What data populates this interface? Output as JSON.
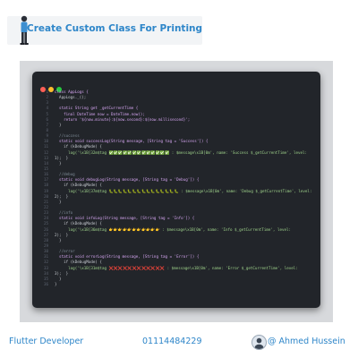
{
  "header": {
    "title": "Create Custom Class For Printing"
  },
  "editor": {
    "window_buttons": [
      "#ff5f56",
      "#ffbd2e",
      "#27c93f"
    ],
    "lines": [
      {
        "n": "1",
        "text": "class AppLogs {"
      },
      {
        "n": "2",
        "text": "  AppLogs._();"
      },
      {
        "n": "3",
        "text": ""
      },
      {
        "n": "4",
        "text": "  static String get _getCurrentTime {"
      },
      {
        "n": "5",
        "text": "    final DateTime now = DateTime.now();"
      },
      {
        "n": "6",
        "text": "    return '${now.minute}:${now.second}:${now.millisecond}';"
      },
      {
        "n": "7",
        "text": "  }"
      },
      {
        "n": "8",
        "text": ""
      },
      {
        "n": "9",
        "text": "  //success"
      },
      {
        "n": "10",
        "text": "  static void successLog(String message, [String tag = 'Success']) {"
      },
      {
        "n": "11",
        "text": "    if (kDebugMode) {"
      },
      {
        "n": "12",
        "text": "      log('\\x1B[32m$tag ✅✅✅✅✅✅✅✅✅✅✅✅✅ : $message\\x1B[0m', name: 'Success $_getCurrentTime', level:"
      },
      {
        "n": "13",
        "text": "1);  }"
      },
      {
        "n": "14",
        "text": "  }"
      },
      {
        "n": "15",
        "text": ""
      },
      {
        "n": "16",
        "text": "  //debug"
      },
      {
        "n": "17",
        "text": "  static void debugLog(String message, [String tag = 'Debug']) {"
      },
      {
        "n": "18",
        "text": "    if (kDebugMode) {"
      },
      {
        "n": "19",
        "text": "      log('\\x1B[37m$tag 🐛🐛🐛🐛🐛🐛🐛🐛🐛🐛🐛🐛🐛🐛🐛 : $message\\x1B[0m', name: 'Debug $_getCurrentTime', level:"
      },
      {
        "n": "20",
        "text": "2);  }"
      },
      {
        "n": "21",
        "text": "  }"
      },
      {
        "n": "22",
        "text": ""
      },
      {
        "n": "23",
        "text": "  //info"
      },
      {
        "n": "24",
        "text": "  static void infoLog(String message, [String tag = 'Info']) {"
      },
      {
        "n": "25",
        "text": "    if (kDebugMode) {"
      },
      {
        "n": "26",
        "text": "      log('\\x1B[36m$tag 👉👉👉👉👉👉👉👉👉👉👉 : $message\\x1B[0m', name: 'Info $_getCurrentTime', level:"
      },
      {
        "n": "27",
        "text": "2);  }"
      },
      {
        "n": "28",
        "text": "  }"
      },
      {
        "n": "29",
        "text": ""
      },
      {
        "n": "30",
        "text": "  //error"
      },
      {
        "n": "31",
        "text": "  static void errorLog(String message, [String tag = 'Error']) {"
      },
      {
        "n": "32",
        "text": "    if (kDebugMode) {"
      },
      {
        "n": "33",
        "text": "      log('\\x1B[31m$tag ❌❌❌❌❌❌❌❌❌❌❌❌ : $message\\x1B[0m', name: 'Error $_getCurrentTime', level:"
      },
      {
        "n": "34",
        "text": "3);  }"
      },
      {
        "n": "35",
        "text": "  }"
      },
      {
        "n": "36",
        "text": "}"
      }
    ]
  },
  "footer": {
    "role": "Flutter Developer",
    "phone": "01114484229",
    "handle": "@ Ahmed Hussein"
  }
}
